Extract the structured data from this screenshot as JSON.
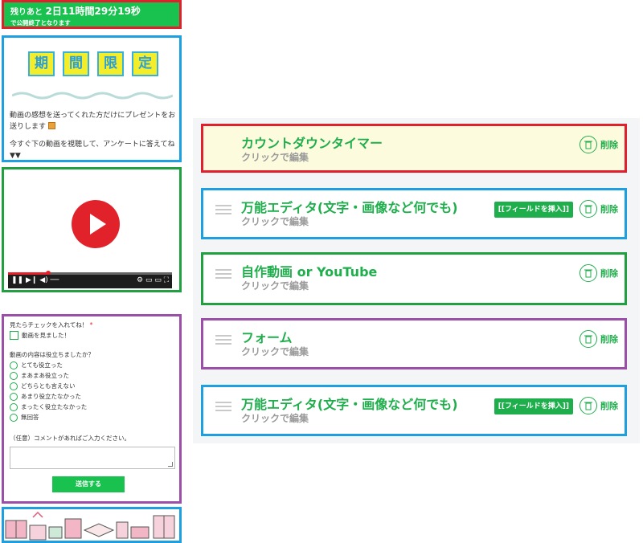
{
  "preview": {
    "timer": {
      "prefix": "残りあと",
      "countdown": "2日11時間29分19秒",
      "suffix": "で公開終了となります",
      "bg_color": "#19c24f"
    },
    "promo": {
      "kanji": [
        "期",
        "間",
        "限",
        "定"
      ],
      "line1": "動画の感想を送ってくれた方だけにプレゼントをお送りします",
      "line2": "今すぐ下の動画を視聴して、アンケートに答えてね▼▼"
    },
    "video": {
      "play_icon": "play-button-icon"
    },
    "form": {
      "q1_label": "見たらチェックを入れてね！",
      "q1_required": "*",
      "q1_option": "動画を見ました！",
      "q2_label": "動画の内容は役立ちましたか？",
      "q2_options": [
        "とても役立った",
        "まあまあ役立った",
        "どちらとも言えない",
        "あまり役立たなかった",
        "まったく役立たなかった",
        "無回答"
      ],
      "comment_label": "（任意）コメントがあればご入力ください。",
      "submit_label": "送信する"
    }
  },
  "editor": {
    "delete_label": "削除",
    "insert_field_label": "[[フィールドを挿入]]",
    "blocks": [
      {
        "title": "カウントダウンタイマー",
        "sub": "クリックで編集"
      },
      {
        "title": "万能エディタ(文字・画像など何でも)",
        "sub": "クリックで編集"
      },
      {
        "title": "自作動画 or YouTube",
        "sub": "クリックで編集"
      },
      {
        "title": "フォーム",
        "sub": "クリックで編集"
      },
      {
        "title": "万能エディタ(文字・画像など何でも)",
        "sub": "クリックで編集"
      }
    ],
    "accent_color": "#1fae4c"
  }
}
